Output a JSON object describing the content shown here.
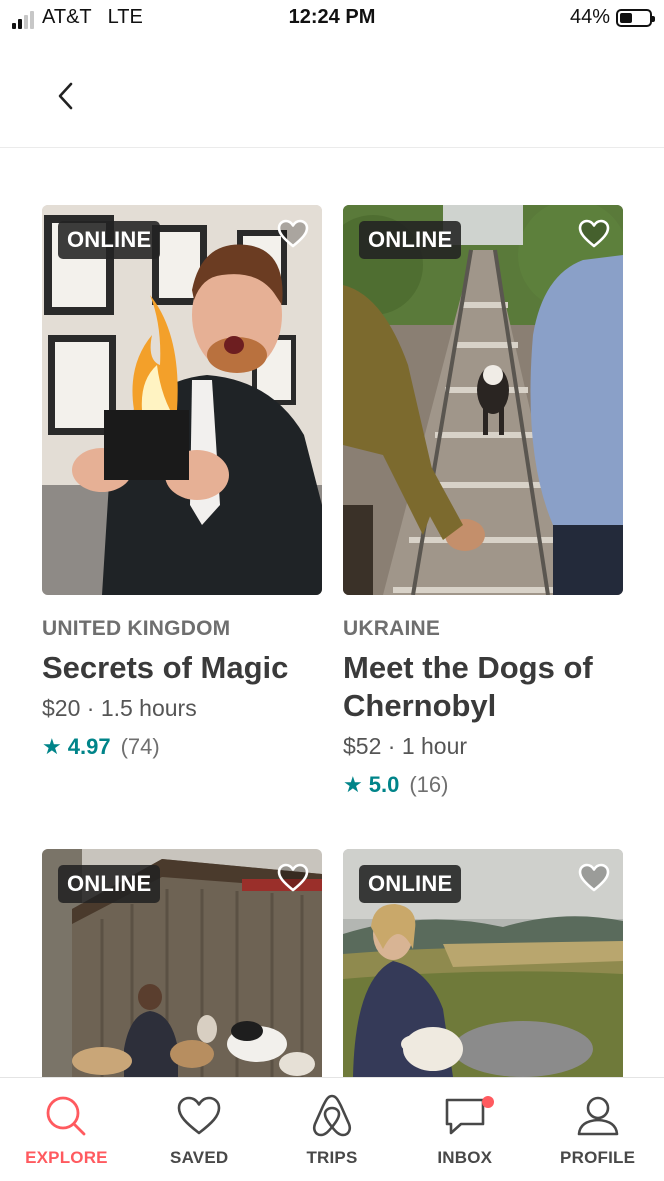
{
  "status_bar": {
    "carrier": "AT&T",
    "network": "LTE",
    "time": "12:24 PM",
    "battery_percent": "44%",
    "battery_level": 0.44
  },
  "header": {
    "back_icon": "chevron-left-icon"
  },
  "cards": [
    {
      "badge": "ONLINE",
      "country": "UNITED KINGDOM",
      "title": "Secrets of Magic",
      "price": "$20 · 1.5 hours",
      "rating": "4.97",
      "reviews": "(74)"
    },
    {
      "badge": "ONLINE",
      "country": "UKRAINE",
      "title": "Meet the Dogs of Chernobyl",
      "price": "$52 · 1 hour",
      "rating": "5.0",
      "reviews": "(16)"
    },
    {
      "badge": "ONLINE"
    },
    {
      "badge": "ONLINE"
    }
  ],
  "bottom_nav": [
    {
      "label": "EXPLORE",
      "icon": "search-icon",
      "active": true
    },
    {
      "label": "SAVED",
      "icon": "heart-icon",
      "active": false
    },
    {
      "label": "TRIPS",
      "icon": "airbnb-logo-icon",
      "active": false
    },
    {
      "label": "INBOX",
      "icon": "chat-bubble-icon",
      "active": false,
      "notification": true
    },
    {
      "label": "PROFILE",
      "icon": "person-icon",
      "active": false
    }
  ],
  "colors": {
    "accent": "#ff5a5f",
    "rating": "#008489"
  }
}
